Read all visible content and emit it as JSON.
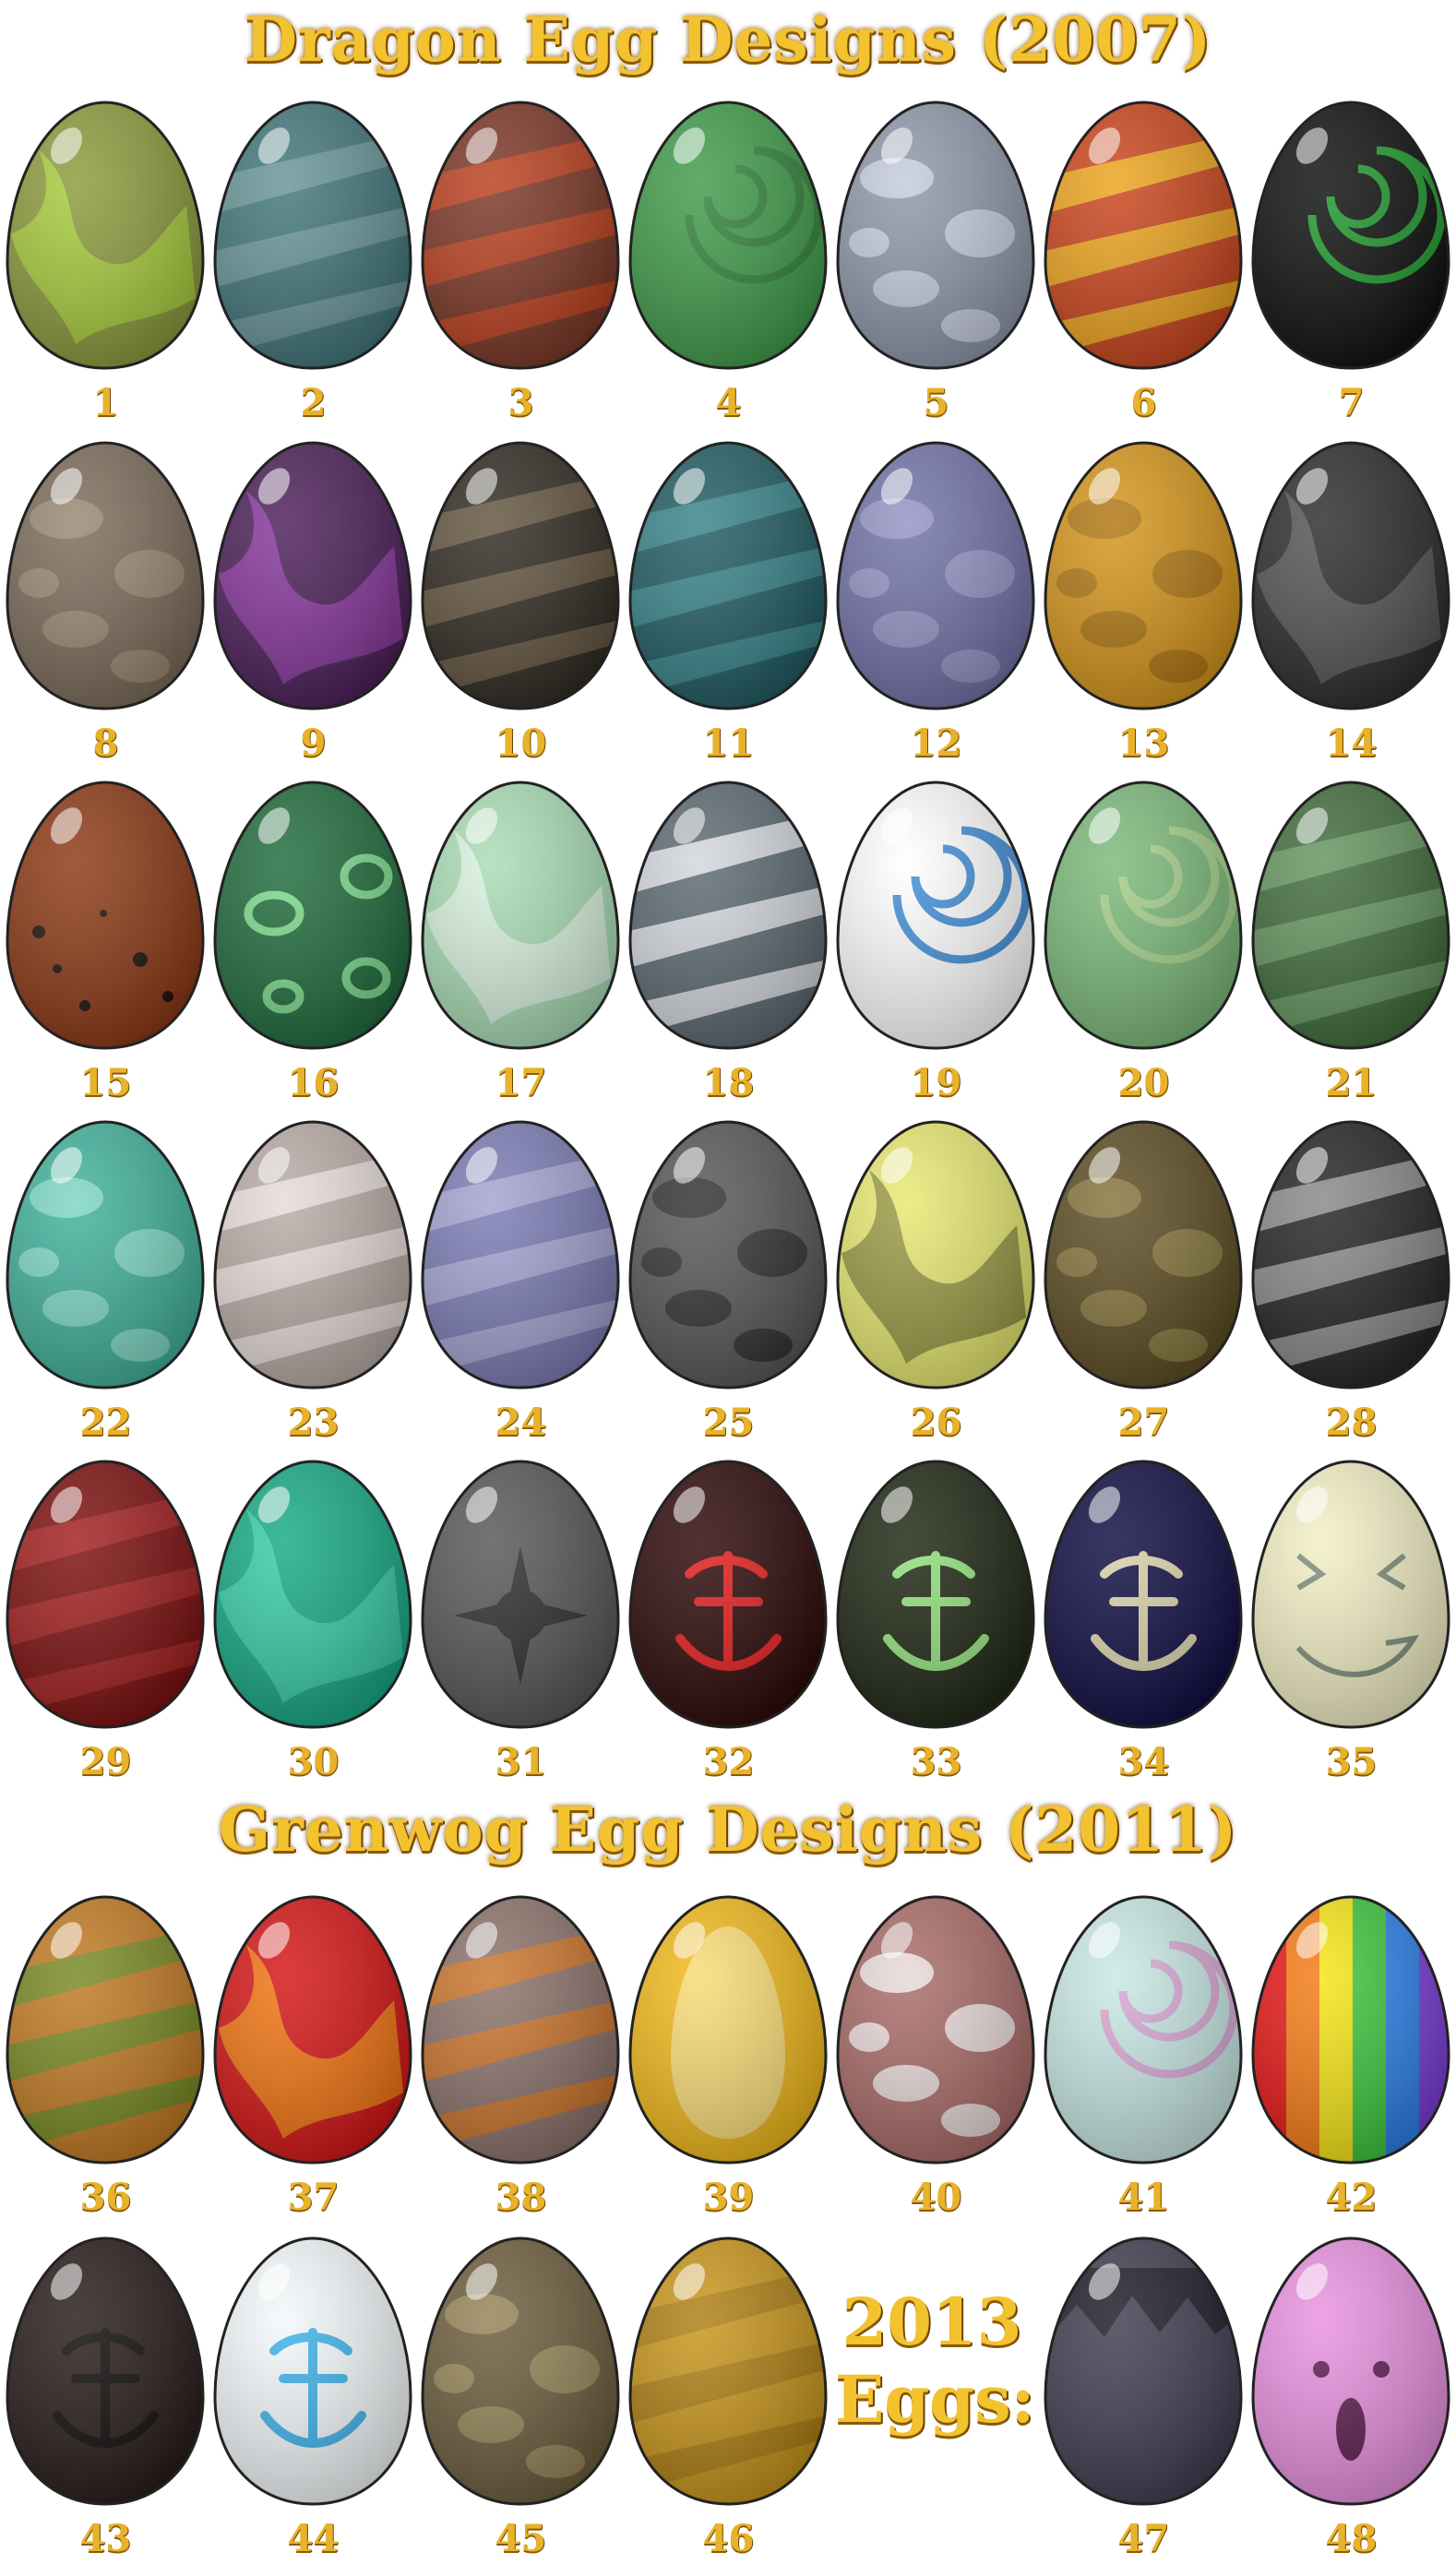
{
  "titles": {
    "dragon": "Dragon Egg Designs (2007)",
    "grenwog": "Grenwog Egg Designs (2011)",
    "eggs2013_year": "2013",
    "eggs2013_label": "Eggs:"
  },
  "eggs": [
    {
      "n": "1",
      "base": "#8a9a3a",
      "pat": "#a9d23a",
      "kind": "swirl"
    },
    {
      "n": "2",
      "base": "#3f7479",
      "pat": "#6e999c",
      "kind": "stripes"
    },
    {
      "n": "3",
      "base": "#7a3424",
      "pat": "#c5401a",
      "kind": "stripes"
    },
    {
      "n": "4",
      "base": "#3e9a48",
      "pat": "#2f7d38",
      "kind": "spiral"
    },
    {
      "n": "5",
      "base": "#8d96a8",
      "pat": "#cdd5e4",
      "kind": "camo"
    },
    {
      "n": "6",
      "base": "#c9431a",
      "pat": "#f2b41e",
      "kind": "stripes"
    },
    {
      "n": "7",
      "base": "#0b0d0b",
      "pat": "#1ea62e",
      "kind": "spiral"
    },
    {
      "n": "8",
      "base": "#7a6a58",
      "pat": "#9d8b76",
      "kind": "camo"
    },
    {
      "n": "9",
      "base": "#4a1c57",
      "pat": "#8e37a3",
      "kind": "swirl"
    },
    {
      "n": "10",
      "base": "#2e2820",
      "pat": "#6a5a44",
      "kind": "stripes"
    },
    {
      "n": "11",
      "base": "#1e5a60",
      "pat": "#3a8a90",
      "kind": "stripes"
    },
    {
      "n": "12",
      "base": "#7070a8",
      "pat": "#9898c8",
      "kind": "camo"
    },
    {
      "n": "13",
      "base": "#d49418",
      "pat": "#a87010",
      "kind": "camo"
    },
    {
      "n": "14",
      "base": "#2a2a2a",
      "pat": "#585858",
      "kind": "swirl"
    },
    {
      "n": "15",
      "base": "#8a3612",
      "pat": "#1c0c06",
      "kind": "spots"
    },
    {
      "n": "16",
      "base": "#1d6a3a",
      "pat": "#7ad88a",
      "kind": "rings"
    },
    {
      "n": "17",
      "base": "#a8dcb4",
      "pat": "#dff5e4",
      "kind": "swirl"
    },
    {
      "n": "18",
      "base": "#5a6870",
      "pat": "#e8ecef",
      "kind": "stripes"
    },
    {
      "n": "19",
      "base": "#ffffff",
      "pat": "#2a7fd0",
      "kind": "spiral"
    },
    {
      "n": "20",
      "base": "#7ab878",
      "pat": "#a8d08a",
      "kind": "spiral"
    },
    {
      "n": "21",
      "base": "#3e6a3a",
      "pat": "#6a9a64",
      "kind": "stripes"
    },
    {
      "n": "22",
      "base": "#3fb09a",
      "pat": "#86dcc8",
      "kind": "camo"
    },
    {
      "n": "23",
      "base": "#b8aaa4",
      "pat": "#eee6e2",
      "kind": "stripes"
    },
    {
      "n": "24",
      "base": "#7a7ab4",
      "pat": "#aaaad8",
      "kind": "stripes"
    },
    {
      "n": "25",
      "base": "#555555",
      "pat": "#2a2a2a",
      "kind": "camo"
    },
    {
      "n": "26",
      "base": "#e8e870",
      "pat": "#8a8a3a",
      "kind": "swirl"
    },
    {
      "n": "27",
      "base": "#5a4a20",
      "pat": "#8a7a40",
      "kind": "camo"
    },
    {
      "n": "28",
      "base": "#222222",
      "pat": "#999999",
      "kind": "stripes"
    },
    {
      "n": "29",
      "base": "#7a0c0c",
      "pat": "#a82020",
      "kind": "stripes"
    },
    {
      "n": "30",
      "base": "#14a884",
      "pat": "#3ad0aa",
      "kind": "swirl"
    },
    {
      "n": "31",
      "base": "#555555",
      "pat": "#2a2a2a",
      "kind": "star"
    },
    {
      "n": "32",
      "base": "#2a0505",
      "pat": "#e41818",
      "kind": "glyph"
    },
    {
      "n": "33",
      "base": "#1c2410",
      "pat": "#8ee07a",
      "kind": "glyph"
    },
    {
      "n": "34",
      "base": "#0c0a40",
      "pat": "#d8d0a8",
      "kind": "glyph"
    },
    {
      "n": "35",
      "base": "#f2efc4",
      "pat": "#7a8a7a",
      "kind": "face"
    },
    {
      "n": "36",
      "base": "#c07820",
      "pat": "#6a8a20",
      "kind": "stripes"
    },
    {
      "n": "37",
      "base": "#d41212",
      "pat": "#f5820e",
      "kind": "swirl"
    },
    {
      "n": "38",
      "base": "#8a7068",
      "pat": "#d4721e",
      "kind": "stripes"
    },
    {
      "n": "39",
      "base": "#f0b818",
      "pat": "#fff6c0",
      "kind": "inner"
    },
    {
      "n": "40",
      "base": "#a86a66",
      "pat": "#f2ecec",
      "kind": "camo"
    },
    {
      "n": "41",
      "base": "#c8e8e4",
      "pat": "#d8a0d0",
      "kind": "spiral"
    },
    {
      "n": "42",
      "base": "#e81414",
      "pat": "#2a7ee8",
      "kind": "rainbow"
    },
    {
      "n": "43",
      "base": "#241816",
      "pat": "#0a0606",
      "kind": "glyph"
    },
    {
      "n": "44",
      "base": "#f4f8fa",
      "pat": "#3ab0e8",
      "kind": "glyph"
    },
    {
      "n": "45",
      "base": "#6a5a3a",
      "pat": "#9a8a5a",
      "kind": "camo"
    },
    {
      "n": "46",
      "base": "#c89418",
      "pat": "#a87a10",
      "kind": "stripes"
    },
    {
      "n": "47",
      "base": "#3e3a4e",
      "pat": "#1a1824",
      "kind": "cracked"
    },
    {
      "n": "48",
      "base": "#e890e0",
      "pat": "#5a1a4a",
      "kind": "bunny"
    }
  ]
}
